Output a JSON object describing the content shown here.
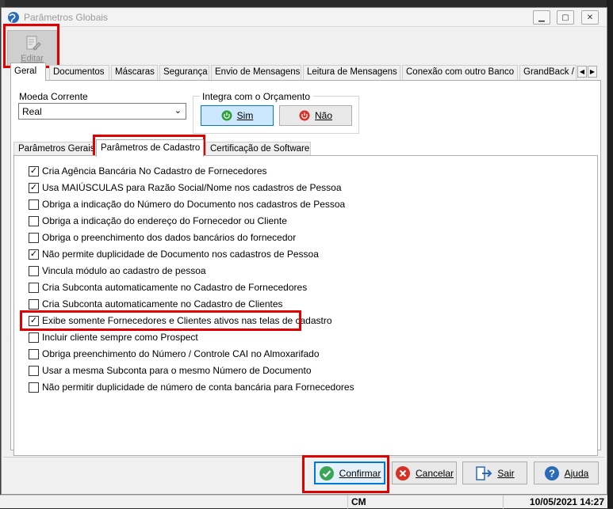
{
  "window": {
    "title": "Parâmetros Globais"
  },
  "toolbar": {
    "edit_label": "Editar"
  },
  "main_tabs": [
    "Geral",
    "Documentos",
    "Máscaras",
    "Segurança",
    "Envio de Mensagens",
    "Leitura de Mensagens",
    "Conexão com outro Banco",
    "GrandBack /"
  ],
  "moeda": {
    "label": "Moeda Corrente",
    "value": "Real"
  },
  "integra": {
    "label": "Integra com o Orçamento",
    "sim": "Sim",
    "nao": "Não"
  },
  "sub_tabs": [
    "Parâmetros Gerais",
    "Parâmetros de Cadastro",
    "Certificação de Software"
  ],
  "options": [
    {
      "label": "Cria Agência Bancária No Cadastro de Fornecedores",
      "checked": true
    },
    {
      "label": "Usa MAIÚSCULAS para Razão Social/Nome nos cadastros de Pessoa",
      "checked": true
    },
    {
      "label": "Obriga a indicação do Número do Documento nos cadastros de Pessoa",
      "checked": false
    },
    {
      "label": "Obriga a indicação do endereço do Fornecedor ou Cliente",
      "checked": false
    },
    {
      "label": "Obriga o preenchimento dos dados bancários do fornecedor",
      "checked": false
    },
    {
      "label": "Não permite duplicidade de Documento nos cadastros de Pessoa",
      "checked": true
    },
    {
      "label": "Vincula módulo ao cadastro de pessoa",
      "checked": false
    },
    {
      "label": "Cria Subconta automaticamente no Cadastro de Fornecedores",
      "checked": false
    },
    {
      "label": "Cria Subconta automaticamente no Cadastro de Clientes",
      "checked": false
    },
    {
      "label": "Exibe somente Fornecedores e Clientes ativos nas telas de cadastro",
      "checked": true
    },
    {
      "label": "Incluir cliente sempre como Prospect",
      "checked": false
    },
    {
      "label": "Obriga preenchimento do Número / Controle CAI no Almoxarifado",
      "checked": false
    },
    {
      "label": "Usar a mesma Subconta para o mesmo Número de Documento",
      "checked": false
    },
    {
      "label": "Não permitir duplicidade de número de conta bancária para Fornecedores",
      "checked": false
    }
  ],
  "buttons": {
    "confirmar": "Confirmar",
    "cancelar": "Cancelar",
    "sair": "Sair",
    "ajuda": "Ajuda"
  },
  "status": {
    "user": "CM",
    "datetime": "10/05/2021 14:27"
  },
  "colors": {
    "highlight": "#e00000",
    "accent": "#0078d7"
  }
}
